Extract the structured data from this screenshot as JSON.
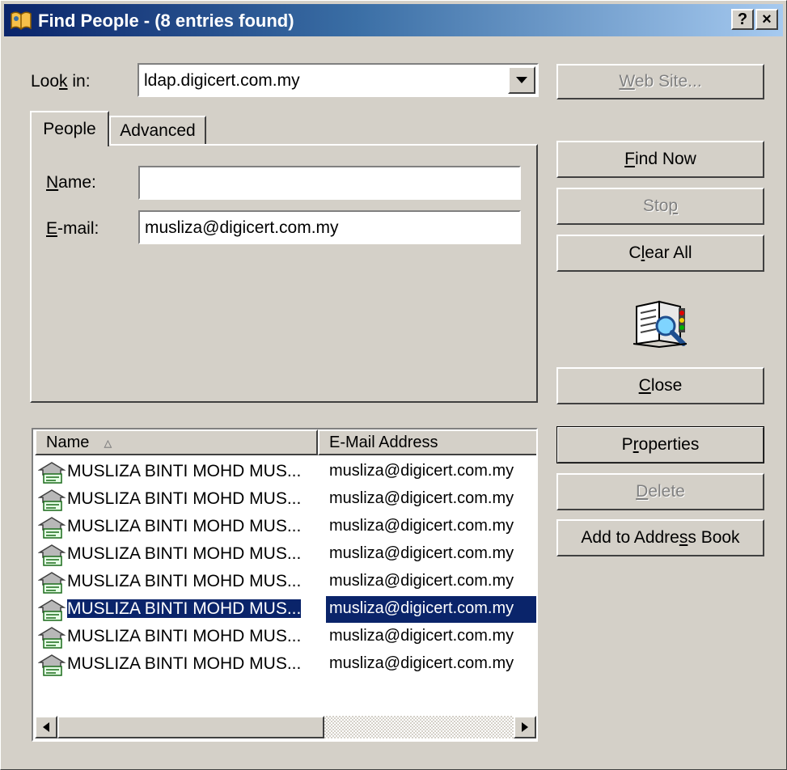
{
  "window": {
    "title": "Find People - (8 entries found)",
    "help_button": "?",
    "close_button": "×"
  },
  "look_in": {
    "label": "Look in:",
    "label_pre": "Loo",
    "label_ul": "k",
    "label_post": " in:",
    "value": "ldap.digicert.com.my"
  },
  "tabs": [
    {
      "label": "People",
      "active": true
    },
    {
      "label": "Advanced",
      "active": false
    }
  ],
  "form": {
    "name": {
      "label": "Name:",
      "ul": "N",
      "rest": "ame:",
      "value": ""
    },
    "email": {
      "label": "E-mail:",
      "ul": "E",
      "rest": "-mail:",
      "value": "musliza@digicert.com.my"
    }
  },
  "buttons": {
    "web_site": {
      "pre": "",
      "ul": "W",
      "post": "eb Site...",
      "enabled": false
    },
    "find_now": {
      "pre": "",
      "ul": "F",
      "post": "ind Now",
      "enabled": true
    },
    "stop": {
      "pre": "Sto",
      "ul": "p",
      "post": "",
      "enabled": false
    },
    "clear_all": {
      "pre": "C",
      "ul": "l",
      "post": "ear All",
      "enabled": true
    },
    "close": {
      "pre": "",
      "ul": "C",
      "post": "lose",
      "enabled": true
    },
    "properties": {
      "pre": "P",
      "ul": "r",
      "post": "operties",
      "enabled": true
    },
    "delete": {
      "pre": "",
      "ul": "D",
      "post": "elete",
      "enabled": false
    },
    "add_to_address_book": {
      "pre": "Add to Addre",
      "ul": "s",
      "post": "s Book",
      "enabled": true
    }
  },
  "results": {
    "columns": [
      "Name",
      "E-Mail Address"
    ],
    "sort_indicator": "▵",
    "rows": [
      {
        "name": "MUSLIZA BINTI MOHD MUS...",
        "email": "musliza@digicert.com.my"
      },
      {
        "name": "MUSLIZA BINTI MOHD MUS...",
        "email": "musliza@digicert.com.my"
      },
      {
        "name": "MUSLIZA BINTI MOHD MUS...",
        "email": "musliza@digicert.com.my"
      },
      {
        "name": "MUSLIZA BINTI MOHD MUS...",
        "email": "musliza@digicert.com.my"
      },
      {
        "name": "MUSLIZA BINTI MOHD MUS...",
        "email": "musliza@digicert.com.my"
      },
      {
        "name": "MUSLIZA BINTI MOHD MUS...",
        "email": "musliza@digicert.com.my",
        "selected": true
      },
      {
        "name": "MUSLIZA BINTI MOHD MUS...",
        "email": "musliza@digicert.com.my"
      },
      {
        "name": "MUSLIZA BINTI MOHD MUS...",
        "email": "musliza@digicert.com.my"
      }
    ]
  },
  "colors": {
    "title_start": "#0a246a",
    "title_end": "#a6caf0",
    "face": "#d4d0c8",
    "selection": "#0a246a"
  }
}
